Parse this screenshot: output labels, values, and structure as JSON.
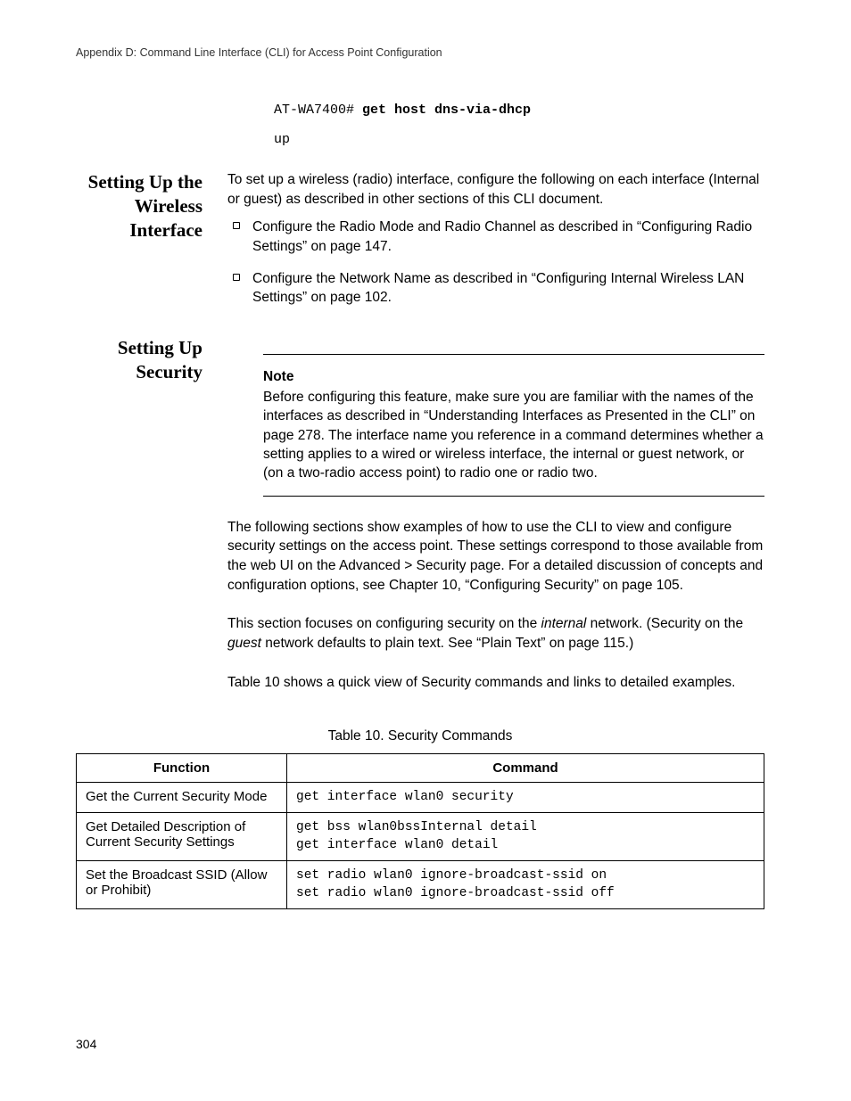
{
  "header": "Appendix D: Command Line Interface (CLI) for Access Point Configuration",
  "code_prompt": "AT-WA7400# ",
  "code_cmd": "get host dns-via-dhcp",
  "code_output": "up",
  "sections": {
    "wireless": {
      "heading": "Setting Up the Wireless Interface",
      "intro": "To set up a wireless (radio) interface, configure the following on each interface (Internal or guest) as described in other sections of this CLI document.",
      "bullets": [
        "Configure the Radio Mode and Radio Channel as described in “Configuring Radio Settings” on page 147.",
        "Configure the Network Name as described in “Configuring Internal Wireless LAN Settings” on page 102."
      ]
    },
    "security": {
      "heading": "Setting Up Security",
      "note_label": "Note",
      "note_body": "Before configuring this feature, make sure you are familiar with the names of the interfaces as described in “Understanding Interfaces as Presented in the CLI” on page 278. The interface name you reference in a command determines whether a setting applies to a wired or wireless interface, the internal or guest network, or (on a two-radio access point) to radio one or radio two.",
      "para1": "The following sections show examples of how to use the CLI to view and configure security settings on the access point. These settings correspond to those available from the web UI on the Advanced > Security page. For a detailed discussion of concepts and configuration options, see Chapter 10, “Configuring Security” on page 105.",
      "para2_pre": "This section focuses on configuring security on the ",
      "para2_em1": "internal",
      "para2_mid": " network. (Security on the ",
      "para2_em2": "guest",
      "para2_post": " network defaults to plain text. See “Plain Text” on page 115.)",
      "para3": "Table 10 shows a quick view of Security commands and links to detailed examples.",
      "table_caption": "Table 10. Security Commands",
      "table_headers": {
        "function": "Function",
        "command": "Command"
      },
      "table_rows": [
        {
          "function": "Get the Current Security Mode",
          "command": "get interface wlan0 security"
        },
        {
          "function": "Get Detailed Description of Current Security Settings",
          "command": "get bss wlan0bssInternal detail\nget interface wlan0 detail"
        },
        {
          "function": "Set the Broadcast SSID (Allow or Prohibit)",
          "command": "set radio wlan0 ignore-broadcast-ssid on\nset radio wlan0 ignore-broadcast-ssid off"
        }
      ]
    }
  },
  "page_number": "304"
}
